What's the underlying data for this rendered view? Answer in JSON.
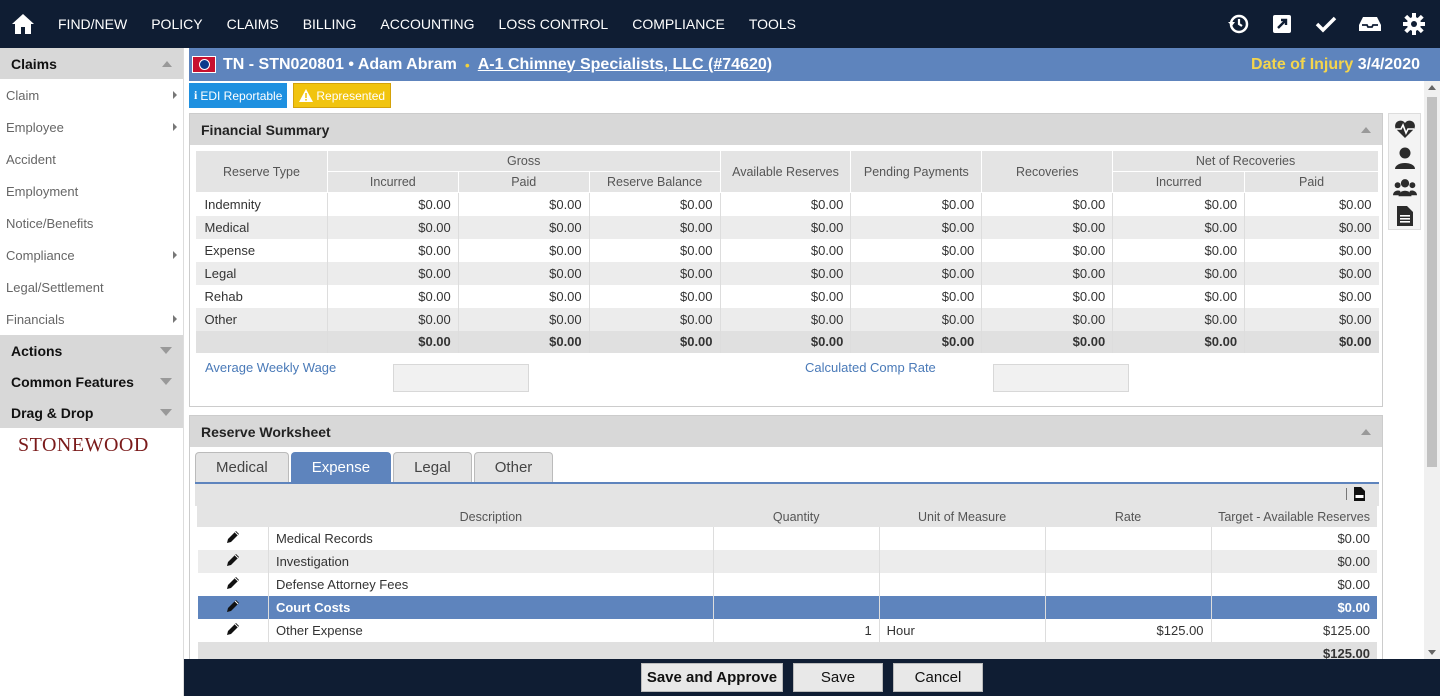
{
  "nav": {
    "items": [
      "FIND/NEW",
      "POLICY",
      "CLAIMS",
      "BILLING",
      "ACCOUNTING",
      "LOSS CONTROL",
      "COMPLIANCE",
      "TOOLS"
    ],
    "right_icons": [
      "history-icon",
      "external-link-icon",
      "checkmark-icon",
      "inbox-icon",
      "gear-icon"
    ]
  },
  "sidebar": {
    "claims_header": "Claims",
    "items": [
      {
        "label": "Claim",
        "has_submenu": true
      },
      {
        "label": "Employee",
        "has_submenu": true
      },
      {
        "label": "Accident",
        "has_submenu": false
      },
      {
        "label": "Employment",
        "has_submenu": false
      },
      {
        "label": "Notice/Benefits",
        "has_submenu": false
      },
      {
        "label": "Compliance",
        "has_submenu": true
      },
      {
        "label": "Legal/Settlement",
        "has_submenu": false
      },
      {
        "label": "Financials",
        "has_submenu": true
      }
    ],
    "sections": [
      "Actions",
      "Common Features",
      "Drag & Drop"
    ],
    "logo_text": "STONEWOOD"
  },
  "header": {
    "title": "TN - STN020801 • Adam Abram",
    "separator": "•",
    "employer_link": "A-1 Chimney Specialists, LLC (#74620)",
    "doi_label": "Date of Injury",
    "doi_value": "3/4/2020"
  },
  "badges": {
    "edi": "EDI Reportable",
    "represented": "Represented"
  },
  "financial_summary": {
    "title": "Financial Summary",
    "headers": {
      "reserve_type": "Reserve Type",
      "gross": "Gross",
      "incurred": "Incurred",
      "paid": "Paid",
      "reserve_balance": "Reserve Balance",
      "available_reserves": "Available Reserves",
      "pending_payments": "Pending Payments",
      "recoveries": "Recoveries",
      "net_of_recoveries": "Net of Recoveries",
      "net_incurred": "Incurred",
      "net_paid": "Paid"
    },
    "rows": [
      {
        "type": "Indemnity",
        "values": [
          "$0.00",
          "$0.00",
          "$0.00",
          "$0.00",
          "$0.00",
          "$0.00",
          "$0.00",
          "$0.00"
        ]
      },
      {
        "type": "Medical",
        "values": [
          "$0.00",
          "$0.00",
          "$0.00",
          "$0.00",
          "$0.00",
          "$0.00",
          "$0.00",
          "$0.00"
        ]
      },
      {
        "type": "Expense",
        "values": [
          "$0.00",
          "$0.00",
          "$0.00",
          "$0.00",
          "$0.00",
          "$0.00",
          "$0.00",
          "$0.00"
        ]
      },
      {
        "type": "Legal",
        "values": [
          "$0.00",
          "$0.00",
          "$0.00",
          "$0.00",
          "$0.00",
          "$0.00",
          "$0.00",
          "$0.00"
        ]
      },
      {
        "type": "Rehab",
        "values": [
          "$0.00",
          "$0.00",
          "$0.00",
          "$0.00",
          "$0.00",
          "$0.00",
          "$0.00",
          "$0.00"
        ]
      },
      {
        "type": "Other",
        "values": [
          "$0.00",
          "$0.00",
          "$0.00",
          "$0.00",
          "$0.00",
          "$0.00",
          "$0.00",
          "$0.00"
        ]
      }
    ],
    "totals": [
      "$0.00",
      "$0.00",
      "$0.00",
      "$0.00",
      "$0.00",
      "$0.00",
      "$0.00",
      "$0.00"
    ],
    "avg_weekly_wage_label": "Average Weekly Wage",
    "avg_weekly_wage_value": "",
    "comp_rate_label": "Calculated Comp Rate",
    "comp_rate_value": ""
  },
  "reserve_worksheet": {
    "title": "Reserve Worksheet",
    "tabs": [
      "Medical",
      "Expense",
      "Legal",
      "Other"
    ],
    "active_tab": "Expense",
    "columns": [
      "Description",
      "Quantity",
      "Unit of Measure",
      "Rate",
      "Target - Available Reserves"
    ],
    "rows": [
      {
        "description": "Medical Records",
        "quantity": "",
        "unit": "",
        "rate": "",
        "target": "$0.00"
      },
      {
        "description": "Investigation",
        "quantity": "",
        "unit": "",
        "rate": "",
        "target": "$0.00"
      },
      {
        "description": "Defense Attorney Fees",
        "quantity": "",
        "unit": "",
        "rate": "",
        "target": "$0.00"
      },
      {
        "description": "Court Costs",
        "quantity": "",
        "unit": "",
        "rate": "",
        "target": "$0.00",
        "selected": true
      },
      {
        "description": "Other Expense",
        "quantity": "1",
        "unit": "Hour",
        "rate": "$125.00",
        "target": "$125.00"
      }
    ],
    "total": "$125.00"
  },
  "footer": {
    "save_approve": "Save and Approve",
    "save": "Save",
    "cancel": "Cancel"
  }
}
